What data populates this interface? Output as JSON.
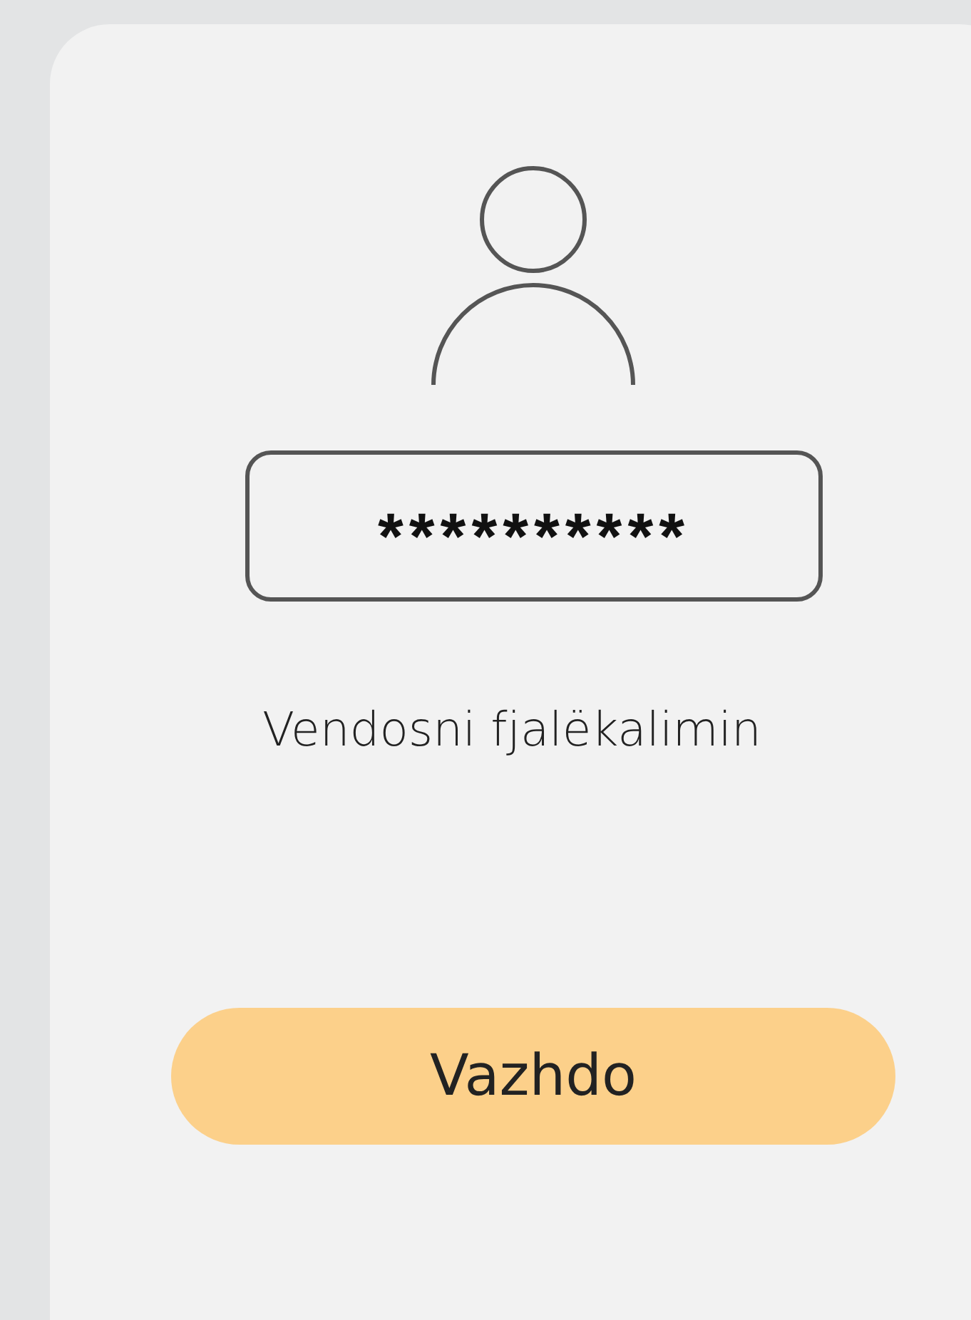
{
  "password_field": {
    "value": "**********"
  },
  "hint": "Vendosni fjalëkalimin",
  "button": {
    "label": "Vazhdo"
  }
}
